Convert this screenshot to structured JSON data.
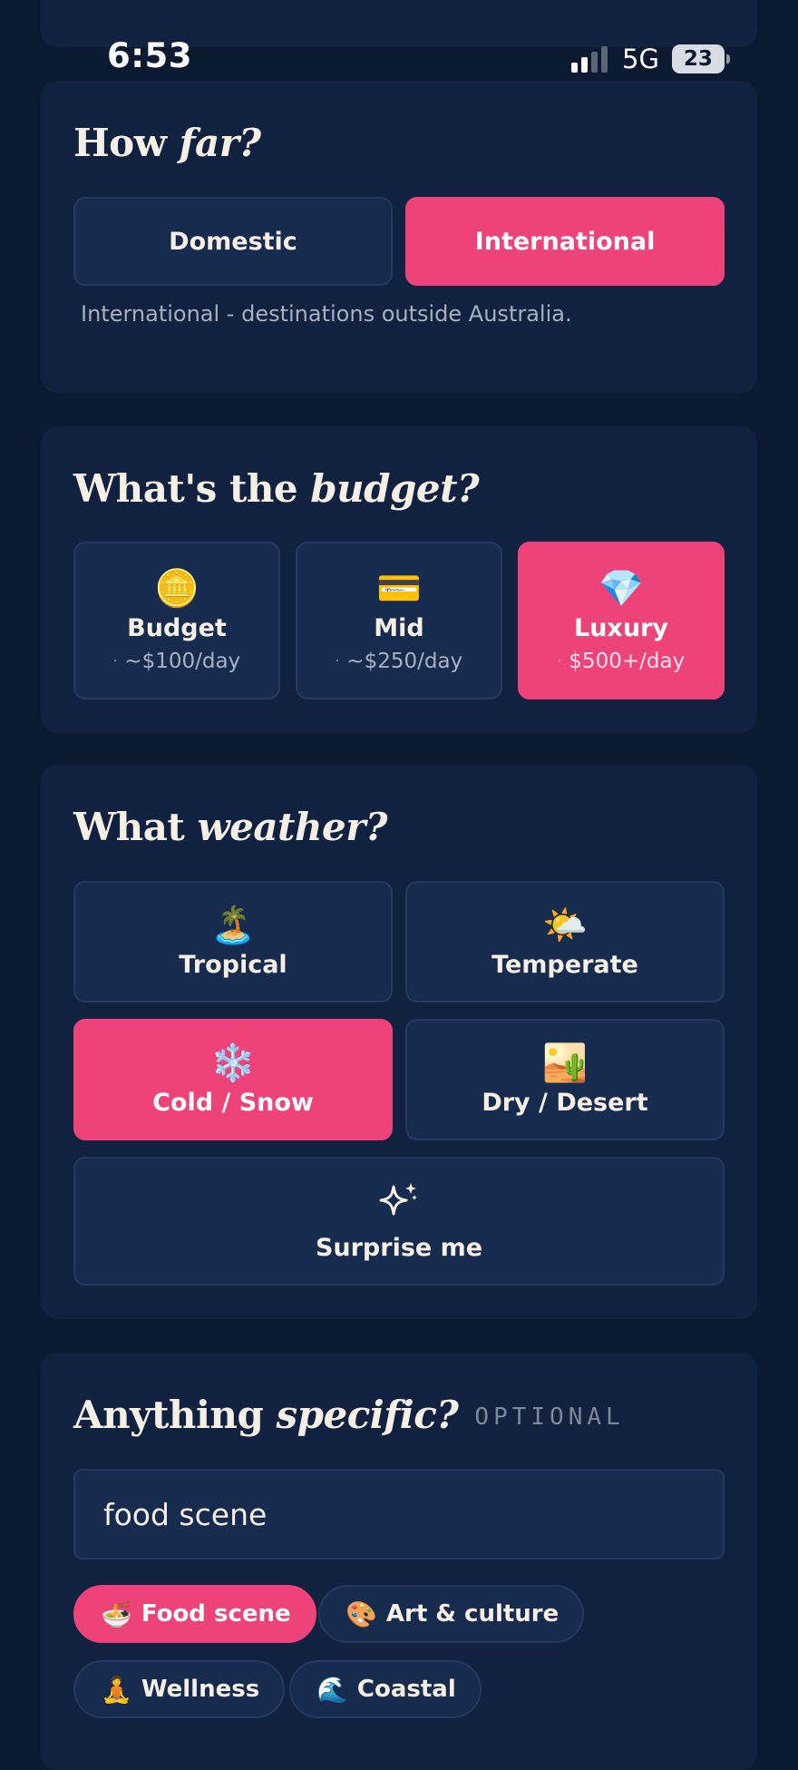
{
  "status_bar": {
    "time": "6:53",
    "network": "5G",
    "battery": "23"
  },
  "distance": {
    "title_plain": "How ",
    "title_em": "far?",
    "options": [
      {
        "label": "Domestic",
        "selected": false
      },
      {
        "label": "International",
        "selected": true
      }
    ],
    "helper": "International - destinations outside Australia."
  },
  "budget": {
    "title_plain": "What's the ",
    "title_em": "budget?",
    "options": [
      {
        "icon": "coin-icon",
        "emoji": "🪙",
        "label": "Budget",
        "dot": "·",
        "sub": "~$100/day",
        "selected": false
      },
      {
        "icon": "credit-card-icon",
        "emoji": "💳",
        "label": "Mid",
        "dot": "·",
        "sub": "~$250/day",
        "selected": false
      },
      {
        "icon": "gem-icon",
        "emoji": "💎",
        "label": "Luxury",
        "dot": "·",
        "sub": "$500+/day",
        "selected": true
      }
    ]
  },
  "weather": {
    "title_plain": "What ",
    "title_em": "weather?",
    "options": [
      {
        "icon": "island-icon",
        "emoji": "🏝️",
        "label": "Tropical",
        "selected": false
      },
      {
        "icon": "sun-cloud-icon",
        "emoji": "🌤️",
        "label": "Temperate",
        "selected": false
      },
      {
        "icon": "snowflake-icon",
        "emoji": "❄️",
        "label": "Cold / Snow",
        "selected": true
      },
      {
        "icon": "desert-icon",
        "emoji": "🏜️",
        "label": "Dry / Desert",
        "selected": false
      },
      {
        "icon": "sparkle-icon",
        "label": "Surprise me",
        "selected": false
      }
    ]
  },
  "specific": {
    "title_plain": "Anything ",
    "title_em": "specific?",
    "optional_label": "OPTIONAL",
    "input_value": "food scene",
    "chips": [
      {
        "icon": "noodle-bowl-icon",
        "emoji": "🍜",
        "label": "Food scene",
        "selected": true
      },
      {
        "icon": "palette-icon",
        "emoji": "🎨",
        "label": "Art & culture",
        "selected": false
      },
      {
        "icon": "meditation-icon",
        "emoji": "🧘",
        "label": "Wellness",
        "selected": false
      },
      {
        "icon": "wave-icon",
        "emoji": "🌊",
        "label": "Coastal",
        "selected": false
      }
    ]
  },
  "colors": {
    "background": "#0b1a30",
    "card": "#10223f",
    "option": "#172b4e",
    "accent": "#ee427a",
    "text": "#f5efe6"
  }
}
